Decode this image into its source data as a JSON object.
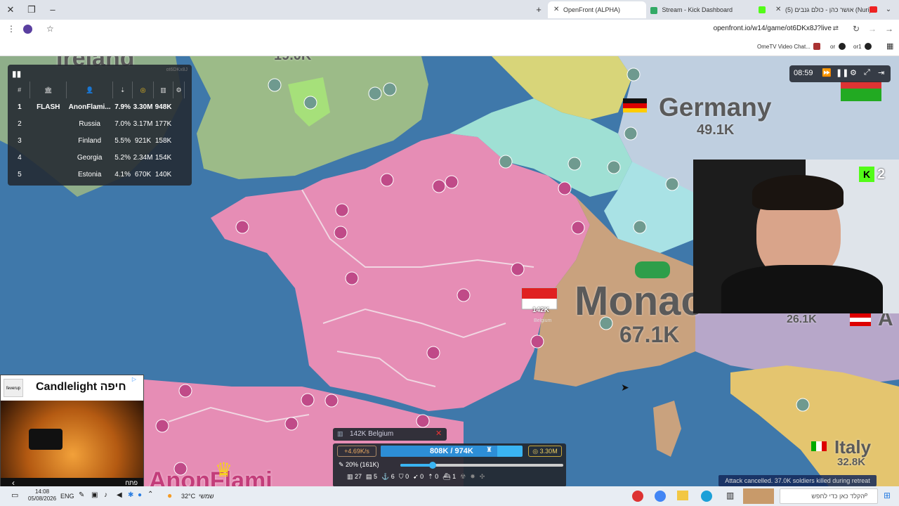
{
  "browser": {
    "tabs": [
      {
        "label": "OpenFront (ALPHA)",
        "active": true
      },
      {
        "label": "Stream - Kick Dashboard",
        "active": false
      },
      {
        "label": "(5) אושר כהן - כולם גנבים (Nuri)",
        "active": false
      }
    ],
    "url": "openfront.io/w14/game/ot6DKx8J?live",
    "bookmarks": [
      "OmeTV Video Chat...",
      "or",
      "or1"
    ]
  },
  "map": {
    "labels": [
      {
        "name": "Germany",
        "troops": "49.1K"
      },
      {
        "name": "Monac",
        "troops": "67.1K"
      },
      {
        "name": "Italy",
        "troops": "32.8K"
      },
      {
        "name": "26.1K",
        "troops": ""
      },
      {
        "name": "A",
        "troops": ""
      },
      {
        "name": "AnonFlami",
        "troops": ""
      },
      {
        "name": "19.0K",
        "troops": ""
      },
      {
        "name": "Ireland",
        "troops": ""
      }
    ],
    "belgium_tag": {
      "troops": "142K",
      "name": "Belgium"
    }
  },
  "leaderboard": {
    "game_id": "ot6DKx8J",
    "headers": [
      "#",
      "",
      "",
      "",
      "",
      "",
      ""
    ],
    "rows": [
      {
        "rank": "1",
        "clan": "FLASH",
        "name": "AnonFlami...",
        "pct": "7.9%",
        "gold": "3.30M",
        "troops": "948K"
      },
      {
        "rank": "2",
        "clan": "",
        "name": "Russia",
        "pct": "7.0%",
        "gold": "3.17M",
        "troops": "177K"
      },
      {
        "rank": "3",
        "clan": "",
        "name": "Finland",
        "pct": "5.5%",
        "gold": "921K",
        "troops": "158K"
      },
      {
        "rank": "4",
        "clan": "",
        "name": "Georgia",
        "pct": "5.2%",
        "gold": "2.34M",
        "troops": "154K"
      },
      {
        "rank": "5",
        "clan": "",
        "name": "Estonia",
        "pct": "4.1%",
        "gold": "670K",
        "troops": "140K"
      }
    ]
  },
  "controls": {
    "timer": "08:59"
  },
  "webcam": {
    "badge_count": "2"
  },
  "ad": {
    "title": "Candlelight חיפה",
    "cta": "פתח"
  },
  "bottom_panel": {
    "target": "142K Belgium",
    "rate": "+4.69K/s",
    "troops": "808K / 974K",
    "gold": "3.30M",
    "attack_ratio": "20% (161K)",
    "attack_ratio_value": 0.2,
    "units": [
      {
        "icon": "city-icon",
        "count": "27"
      },
      {
        "icon": "factory-icon",
        "count": "5"
      },
      {
        "icon": "port-icon",
        "count": "6"
      },
      {
        "icon": "defense-icon",
        "count": "0"
      },
      {
        "icon": "missile-icon",
        "count": "0"
      },
      {
        "icon": "sam-icon",
        "count": "0"
      },
      {
        "icon": "warship-icon",
        "count": "1"
      }
    ]
  },
  "toast": {
    "message": "Attack cancelled. 37.0K soldiers killed during retreat"
  },
  "taskbar": {
    "time": "14:08",
    "date": "05/08/2026",
    "lang": "ENG",
    "weather": "32°C",
    "weather_label": "שמשי",
    "search_placeholder": "הקלד כאן כדי לחפש"
  },
  "colors": {
    "sea": "#3f78aa",
    "france": "#e68db5",
    "germany_teal": "#9fe0d4",
    "uk_green": "#a6d98a",
    "switzerland": "#c9a27e",
    "italy": "#e4c56f",
    "germany_yellow": "#d8d579"
  }
}
